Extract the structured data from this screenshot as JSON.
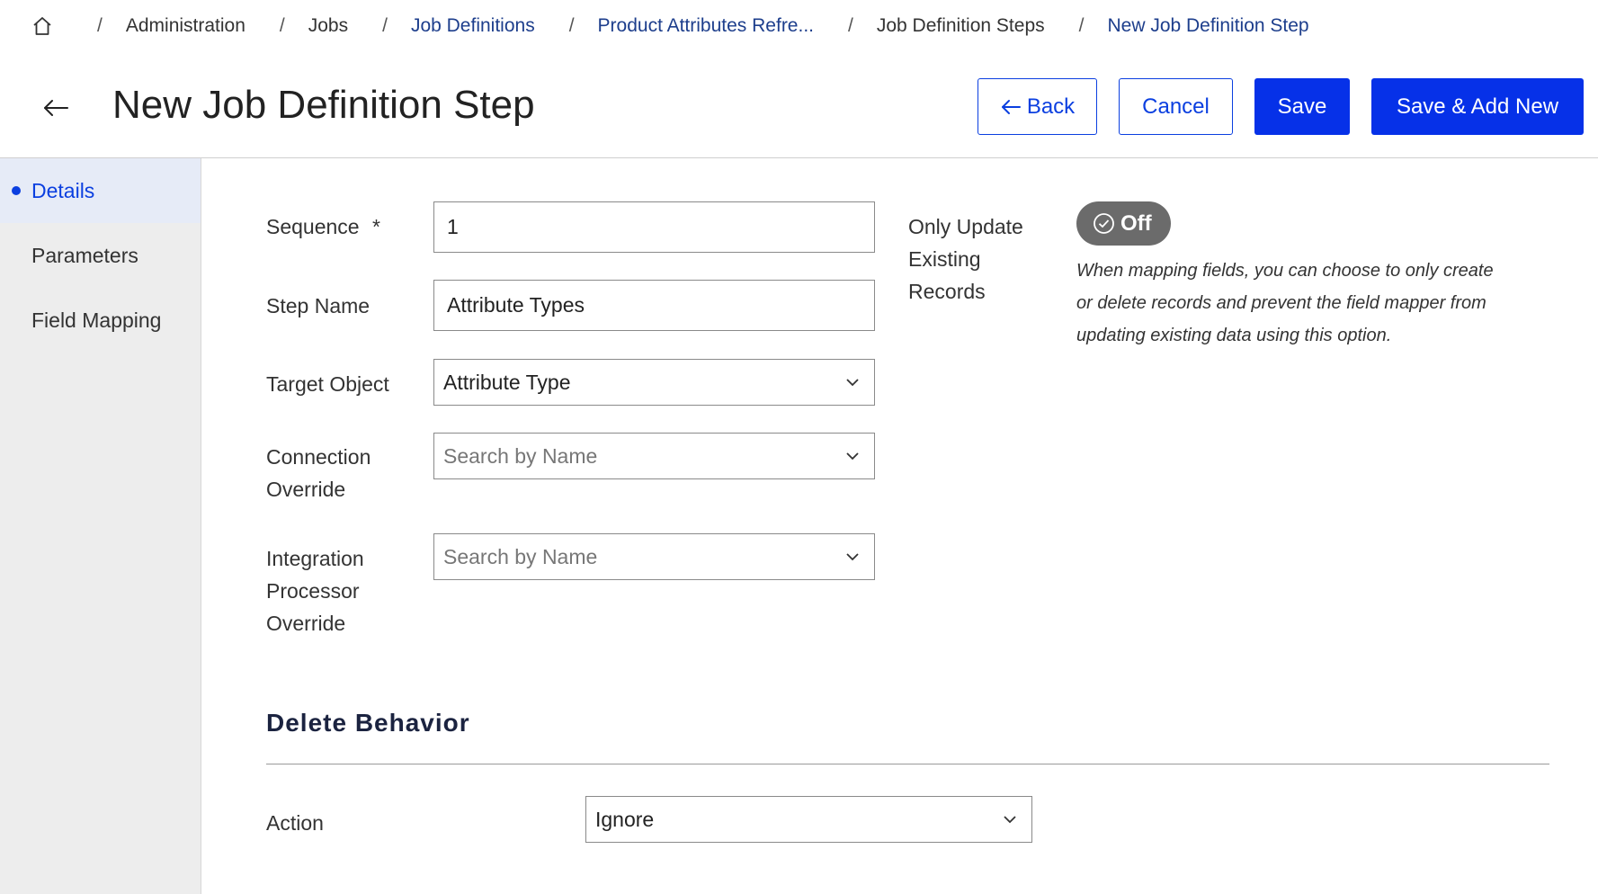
{
  "breadcrumb": {
    "items": [
      {
        "label": "Administration"
      },
      {
        "label": "Jobs"
      },
      {
        "label": "Job Definitions"
      },
      {
        "label": "Product Attributes Refre..."
      },
      {
        "label": "Job Definition Steps"
      },
      {
        "label": "New Job Definition Step"
      }
    ],
    "separator": "/"
  },
  "header": {
    "title": "New Job Definition Step",
    "buttons": {
      "back": "Back",
      "cancel": "Cancel",
      "save": "Save",
      "save_add_new": "Save & Add New"
    }
  },
  "sidebar": {
    "items": [
      {
        "label": "Details",
        "active": true
      },
      {
        "label": "Parameters",
        "active": false
      },
      {
        "label": "Field Mapping",
        "active": false
      }
    ]
  },
  "form": {
    "sequence": {
      "label": "Sequence",
      "required_marker": "*",
      "value": "1"
    },
    "step_name": {
      "label": "Step Name",
      "value": "Attribute Types"
    },
    "target_object": {
      "label": "Target Object",
      "value": "Attribute Type"
    },
    "connection_override": {
      "label_line1": "Connection",
      "label_line2": "Override",
      "placeholder": "Search by Name"
    },
    "integration_processor_override": {
      "label_line1": "Integration",
      "label_line2": "Processor",
      "label_line3": "Override",
      "placeholder": "Search by Name"
    },
    "only_update_existing": {
      "label_line1": "Only Update",
      "label_line2": "Existing",
      "label_line3": "Records",
      "toggle_value": "Off",
      "help_line1": "When mapping fields, you can choose to only create",
      "help_line2": "or delete records and prevent the field mapper from",
      "help_line3": "updating existing data using this option."
    }
  },
  "delete_behavior": {
    "title": "Delete Behavior",
    "action": {
      "label": "Action",
      "value": "Ignore"
    }
  },
  "colors": {
    "primary": "#0631e8",
    "link": "#1d3e8c",
    "sidebar_bg": "#ededed",
    "sidebar_active_bg": "#e6ebf7",
    "toggle_off": "#6b6b6b"
  }
}
